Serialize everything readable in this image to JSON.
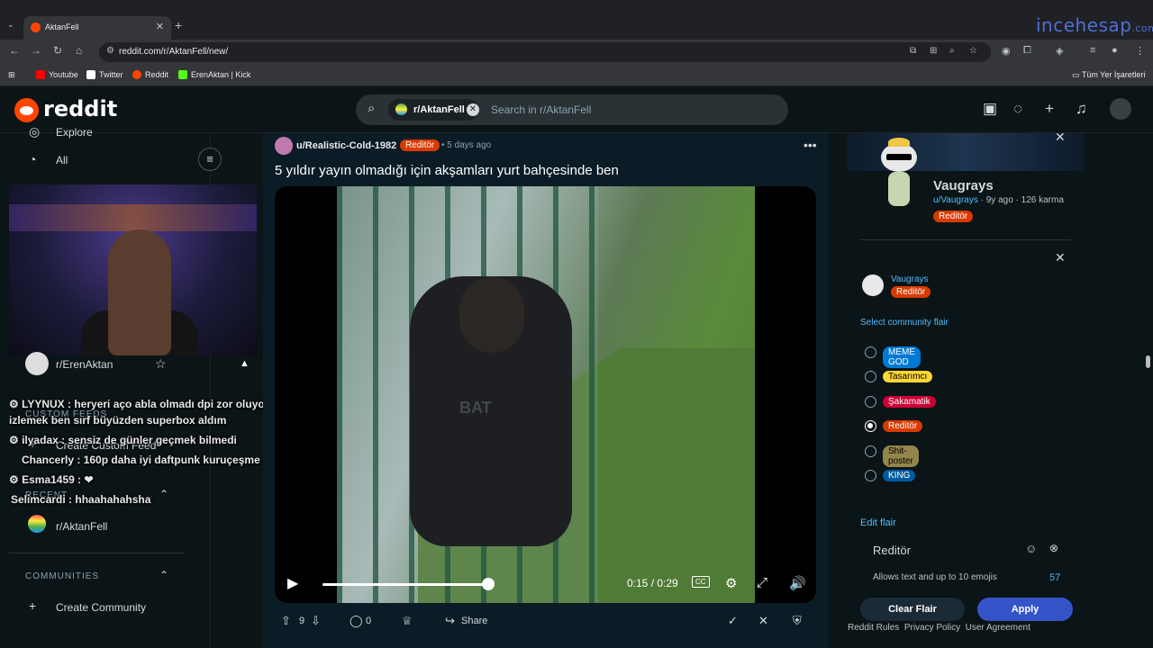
{
  "browser": {
    "tab_title": "AktanFell",
    "url": "reddit.com/r/AktanFell/new/",
    "watermark": "incehesap",
    "watermark_suffix": ".com",
    "bookmarks": [
      "Youtube",
      "Twitter",
      "Reddit",
      "ErenAktan | Kick"
    ],
    "bookmarks_right": "Tüm Yer İşaretleri"
  },
  "header": {
    "logo": "reddit",
    "search_chip": "r/AktanFell",
    "search_placeholder": "Search in r/AktanFell"
  },
  "sidebar": {
    "explore": "Explore",
    "all": "All",
    "pinned_sub": "r/ErenAktan",
    "custom_feeds_head": "CUSTOM FEEDS",
    "create_custom_feed": "Create Custom Feed",
    "recent_head": "RECENT",
    "recent_sub": "r/AktanFell",
    "communities_head": "COMMUNITIES",
    "create_community": "Create Community"
  },
  "chat": [
    {
      "user": "LYYNUX",
      "msg": ": heryeri aço abla olmadı dpi zor oluyor"
    },
    {
      "user": "",
      "msg": "izlemek ben sırf büyüzden superbox aldım"
    },
    {
      "user": "ilyadax",
      "msg": ": sensiz de günler geçmek bilmedi"
    },
    {
      "user": "Chancerly",
      "msg": ": 160p daha iyi daftpunk kuruçeşme"
    },
    {
      "user": "Esma1459",
      "msg": ": ❤"
    },
    {
      "user": "Selimcardi",
      "msg": ": hhaahahahsha"
    }
  ],
  "post": {
    "author": "u/Realistic-Cold-1982",
    "flair": "Reditör",
    "time": "5 days ago",
    "title": "5 yıldır yayın olmadığı için akşamları yurt bahçesinde ben",
    "shirt_text": "BAT",
    "video": {
      "current": "0:15",
      "duration": "0:29",
      "progress": 0.52,
      "time_label": "0:15 / 0:29",
      "cc": "CC"
    },
    "votes": "9",
    "comments": "0",
    "share": "Share"
  },
  "profile": {
    "name": "Vaugrays",
    "username": "u/Vaugrays",
    "meta": " · 9y ago · 126 karma",
    "flair": "Reditör"
  },
  "flair_editor": {
    "user": "Vaugrays",
    "current_flair": "Reditör",
    "select_label": "Select community flair",
    "options": [
      {
        "label": "MEME GOD",
        "color": "#0079d3",
        "text_color": "#ffffff",
        "selected": false
      },
      {
        "label": "Tasarımcı",
        "color": "#ffd635",
        "text_color": "#000000",
        "selected": false
      },
      {
        "label": "Şakamatik",
        "color": "#cc0036",
        "text_color": "#ffffff",
        "selected": false
      },
      {
        "label": "Reditör",
        "color": "#d93a00",
        "text_color": "#ffffff",
        "selected": true
      },
      {
        "label": "Shit-poster",
        "color": "#94854a",
        "text_color": "#000000",
        "selected": false
      },
      {
        "label": "KING",
        "color": "#005ba1",
        "text_color": "#ffffff",
        "selected": false
      }
    ],
    "edit_label": "Edit flair",
    "edit_value": "Reditör",
    "hint": "Allows text and up to 10 emojis",
    "remaining": "57",
    "clear": "Clear Flair",
    "apply": "Apply"
  },
  "footer": [
    "Reddit Rules",
    "Privacy Policy",
    "User Agreement"
  ],
  "colors": {
    "reddit_orange": "#ff4500",
    "flair_reditor": "#d93a00",
    "link_blue": "#4fbcff",
    "apply_blue": "#3553c9"
  }
}
